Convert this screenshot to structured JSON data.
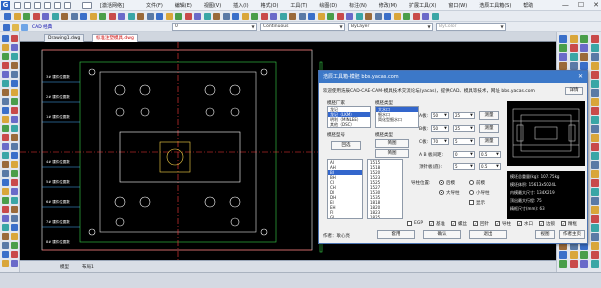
{
  "app": {
    "title": "浩辰CAD",
    "doc_title": "[激活网络]",
    "menu": [
      "文件(F)",
      "编辑(E)",
      "视图(V)",
      "插入(I)",
      "格式(O)",
      "工具(T)",
      "绘图(D)",
      "标注(N)",
      "修改(M)",
      "扩展工具(X)",
      "窗口(W)",
      "浩辰工具箱(S)",
      "帮助"
    ],
    "window_buttons": [
      "—",
      "☐",
      "✕"
    ]
  },
  "toolbar": {
    "layer_combo": "0",
    "linetype_combo": "Continuous",
    "lineweight_combo": "ByLayer",
    "color_combo": "ByColor",
    "workspace_label": "CAD 经典"
  },
  "doctabs": [
    {
      "label": "Drawing1.dwg",
      "active": false
    },
    {
      "label": "标准注塑模具.dwg",
      "active": true
    }
  ],
  "canvas": {
    "labels": [
      "3# 镶件位置数",
      "2# 镶件位置数",
      "1# 镶件位置数",
      "4# 镶件位置数",
      "5# 镶件位置数",
      "6# 镶件位置数",
      "7# 镶件位置数",
      "8# 镶件位置数"
    ]
  },
  "bottom": {
    "model_tab": "模型",
    "layout_tab": "布局1",
    "coords": "0.0000, 0.0000, 0.0000"
  },
  "dialog": {
    "title": "浩辰工具箱-模胚  bbs.yacas.com",
    "ad_text": "欢迎使用浩辰CAD-CAE-CAM-模具技术交流论坛(yacas)，提供CAD、模具等技术，网址 bbs.yacas.com",
    "ad_button": "详情",
    "mold_type_label": "模胚厂家",
    "mold_type_items": [
      "龙记",
      "龙记（LKM）",
      "明利（MINLEE）",
      "其他（DSC）"
    ],
    "series_label": "模胚类型",
    "series_items": [
      "大水口",
      "细水口",
      "简化型细水口"
    ],
    "size_label": "模胚型号",
    "size_items": [
      "1515",
      "1518",
      "1520",
      "1523",
      "1525",
      "1527",
      "1530",
      "1535",
      "1818",
      "1820",
      "1823",
      "1825",
      "1830",
      "1835",
      "1840",
      "2020",
      "2023",
      "2025",
      "2030",
      "2035",
      "2040",
      "2045",
      "2050"
    ],
    "model_items": [
      "AI",
      "AH",
      "BI",
      "BH",
      "CI",
      "CH",
      "DI",
      "DH",
      "EI",
      "EH",
      "FI",
      "GI"
    ],
    "btn_draw": "回选",
    "btn_section": "简图",
    "plate_a_label": "A板:",
    "plate_a_value": "50",
    "plate_b_label": "B板:",
    "plate_b_value": "50",
    "plate_c_label": "C板:",
    "plate_c_value": "70",
    "ab_label": "A B 板间距:",
    "ab_value": "0",
    "sup_label": "顶针板(底):",
    "sup_value": "5",
    "opts_a": [
      "25",
      "25",
      "5",
      "0.5"
    ],
    "btn_plus": "测量",
    "direction_label": "导柱位置:",
    "dir_options": [
      "后模",
      "前模"
    ],
    "dir_opts2": [
      "大导柱",
      "小导柱"
    ],
    "extra_checkbox": "显示",
    "bottom_checks": [
      "EGP",
      "基准",
      "螺丝",
      "回针",
      "导柱",
      "水口",
      "边锁",
      "精框"
    ],
    "info_lines": [
      "模坯总重量(kg): 107.75kg",
      "模坯体积: 15613x5024L",
      "内模最大尺寸: 134X219",
      "顶出最大行程: 75",
      "精框尺寸(mm): 63"
    ],
    "footer_label": "作者：耿心亮",
    "buttons": [
      "套用",
      "确认",
      "退出",
      "视图",
      "作者主页"
    ]
  }
}
